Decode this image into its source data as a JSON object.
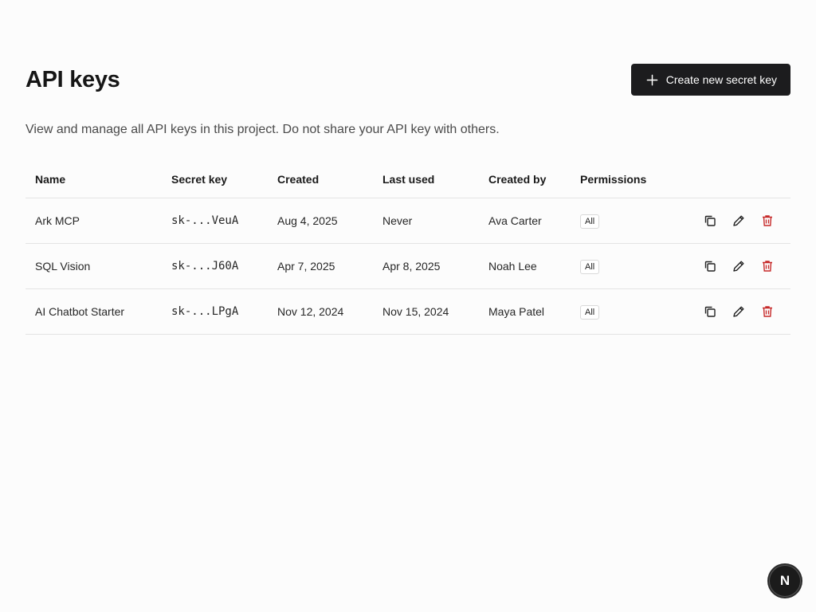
{
  "page": {
    "title": "API keys",
    "description": "View and manage all API keys in this project. Do not share your API key with others.",
    "create_button_label": "Create new secret key"
  },
  "table": {
    "columns": [
      "Name",
      "Secret key",
      "Created",
      "Last used",
      "Created by",
      "Permissions"
    ],
    "rows": [
      {
        "name": "Ark MCP",
        "secret": "sk-...VeuA",
        "created": "Aug 4, 2025",
        "last_used": "Never",
        "created_by": "Ava Carter",
        "permissions": "All"
      },
      {
        "name": "SQL Vision",
        "secret": "sk-...J60A",
        "created": "Apr 7, 2025",
        "last_used": "Apr 8, 2025",
        "created_by": "Noah Lee",
        "permissions": "All"
      },
      {
        "name": "AI Chatbot Starter",
        "secret": "sk-...LPgA",
        "created": "Nov 12, 2024",
        "last_used": "Nov 15, 2024",
        "created_by": "Maya Patel",
        "permissions": "All"
      }
    ],
    "row_actions": [
      "copy-icon",
      "edit-icon",
      "trash-icon"
    ]
  },
  "fab": {
    "label": "N"
  },
  "colors": {
    "primary_button": "#1c1c1e",
    "danger": "#c62828",
    "border": "#e4e4e4"
  }
}
